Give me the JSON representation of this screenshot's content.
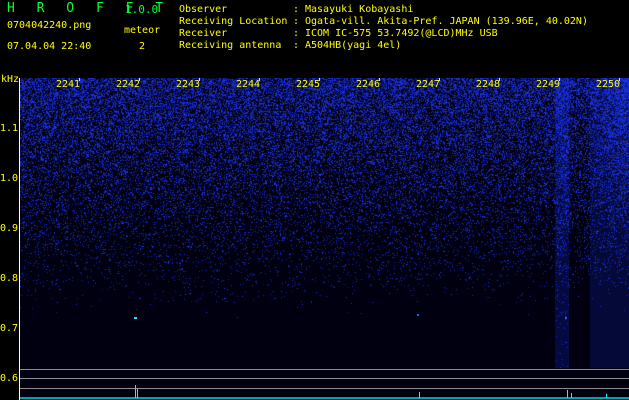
{
  "header": {
    "app_title": "H R O F F T",
    "app_version": "1.0.0",
    "filename": "0704042240.png",
    "timestamp": "07.04.04 22:40",
    "meteor_label": "meteor",
    "meteor_count": "2"
  },
  "info": [
    {
      "label": "Observer",
      "value": "Masayuki Kobayashi"
    },
    {
      "label": "Receiving Location",
      "value": "Ogata-vill. Akita-Pref. JAPAN (139.96E, 40.02N)"
    },
    {
      "label": "Receiver",
      "value": "ICOM IC-575 53.7492(@LCD)MHz USB"
    },
    {
      "label": "Receiving antenna",
      "value": "A504HB(yagi 4el)"
    }
  ],
  "separator": ":",
  "spectrogram": {
    "y_unit": "kHz",
    "y_ticks": [
      "1.1",
      "1.0",
      "0.9",
      "0.8",
      "0.7",
      "0.6"
    ],
    "time_labels": [
      "2241",
      "2242",
      "2243",
      "2244",
      "2245",
      "2246",
      "2247",
      "2248",
      "2249",
      "2250"
    ],
    "colors": {
      "background": "#000000",
      "label": "#ffff00",
      "title": "#00ff33",
      "noise": "#1e3cff",
      "baseline": "#00a6a6",
      "guide": "#8c8c8c"
    }
  }
}
